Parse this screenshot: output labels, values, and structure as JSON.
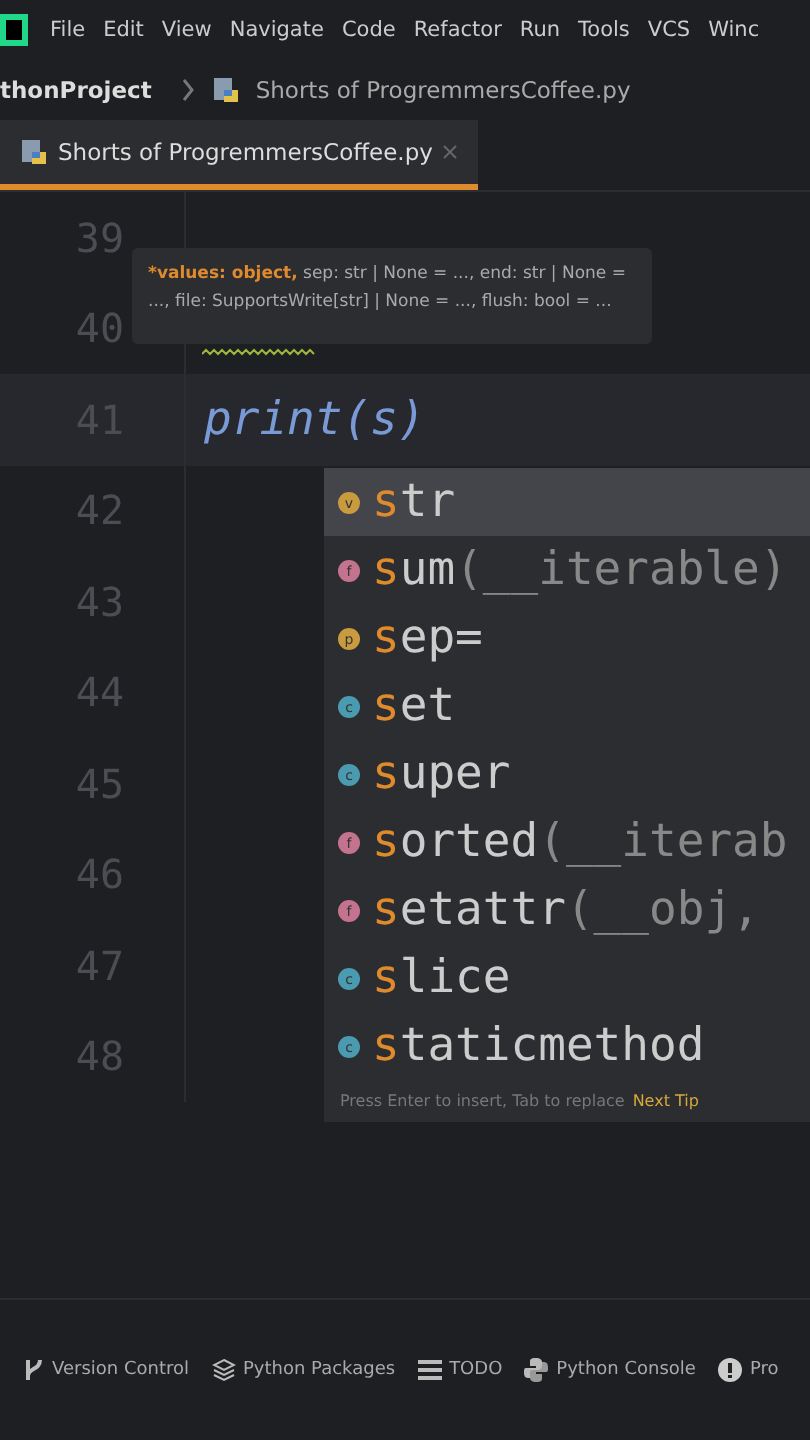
{
  "menu": [
    "File",
    "Edit",
    "View",
    "Navigate",
    "Code",
    "Refactor",
    "Run",
    "Tools",
    "VCS",
    "Winc"
  ],
  "breadcrumb": {
    "project": "thonProject",
    "file": "Shorts of ProgremmersCoffee.py"
  },
  "tabs": [
    {
      "label": "Shorts of ProgremmersCoffee.py",
      "selected": true
    }
  ],
  "editor": {
    "lines": [
      {
        "number": "39",
        "current": false
      },
      {
        "number": "40",
        "current": false
      },
      {
        "number": "41",
        "code": "print(s)",
        "current": true
      },
      {
        "number": "42",
        "current": false
      },
      {
        "number": "43",
        "current": false
      },
      {
        "number": "44",
        "current": false
      },
      {
        "number": "45",
        "current": false
      },
      {
        "number": "46",
        "current": false
      },
      {
        "number": "47",
        "current": false
      },
      {
        "number": "48",
        "current": false
      }
    ]
  },
  "parameter_hint": {
    "current_param": "*values: object,",
    "rest": " sep: str | None = ..., end: str | None = ..., file: SupportsWrite[str] | None = ..., flush: bool = ..."
  },
  "completion": {
    "items": [
      {
        "kind": "v",
        "color": "#c99b3f",
        "match": "s",
        "rest": "tr",
        "selected": true
      },
      {
        "kind": "f",
        "color": "#c4738f",
        "match": "s",
        "rest": "um",
        "params": "(__iterable)",
        "selected": false
      },
      {
        "kind": "p",
        "color": "#c99b3f",
        "match": "s",
        "rest": "ep=",
        "selected": false
      },
      {
        "kind": "c",
        "color": "#4a9bb0",
        "match": "s",
        "rest": "et",
        "selected": false
      },
      {
        "kind": "c",
        "color": "#4a9bb0",
        "match": "s",
        "rest": "uper",
        "selected": false
      },
      {
        "kind": "f",
        "color": "#c4738f",
        "match": "s",
        "rest": "orted",
        "params": "(__iterab",
        "selected": false
      },
      {
        "kind": "f",
        "color": "#c4738f",
        "match": "s",
        "rest": "etattr",
        "params": "(__obj, ",
        "selected": false
      },
      {
        "kind": "c",
        "color": "#4a9bb0",
        "match": "s",
        "rest": "lice",
        "selected": false
      },
      {
        "kind": "c",
        "color": "#4a9bb0",
        "match": "s",
        "rest": "taticmethod",
        "selected": false
      }
    ],
    "footer": "Press Enter to insert, Tab to replace",
    "tip_link": "Next Tip"
  },
  "tool_windows": [
    {
      "kind": "vcs",
      "label": "Version Control"
    },
    {
      "kind": "packages",
      "label": "Python Packages"
    },
    {
      "kind": "todo",
      "label": "TODO"
    },
    {
      "kind": "console",
      "label": "Python Console"
    },
    {
      "kind": "problems",
      "label": "Pro"
    }
  ]
}
